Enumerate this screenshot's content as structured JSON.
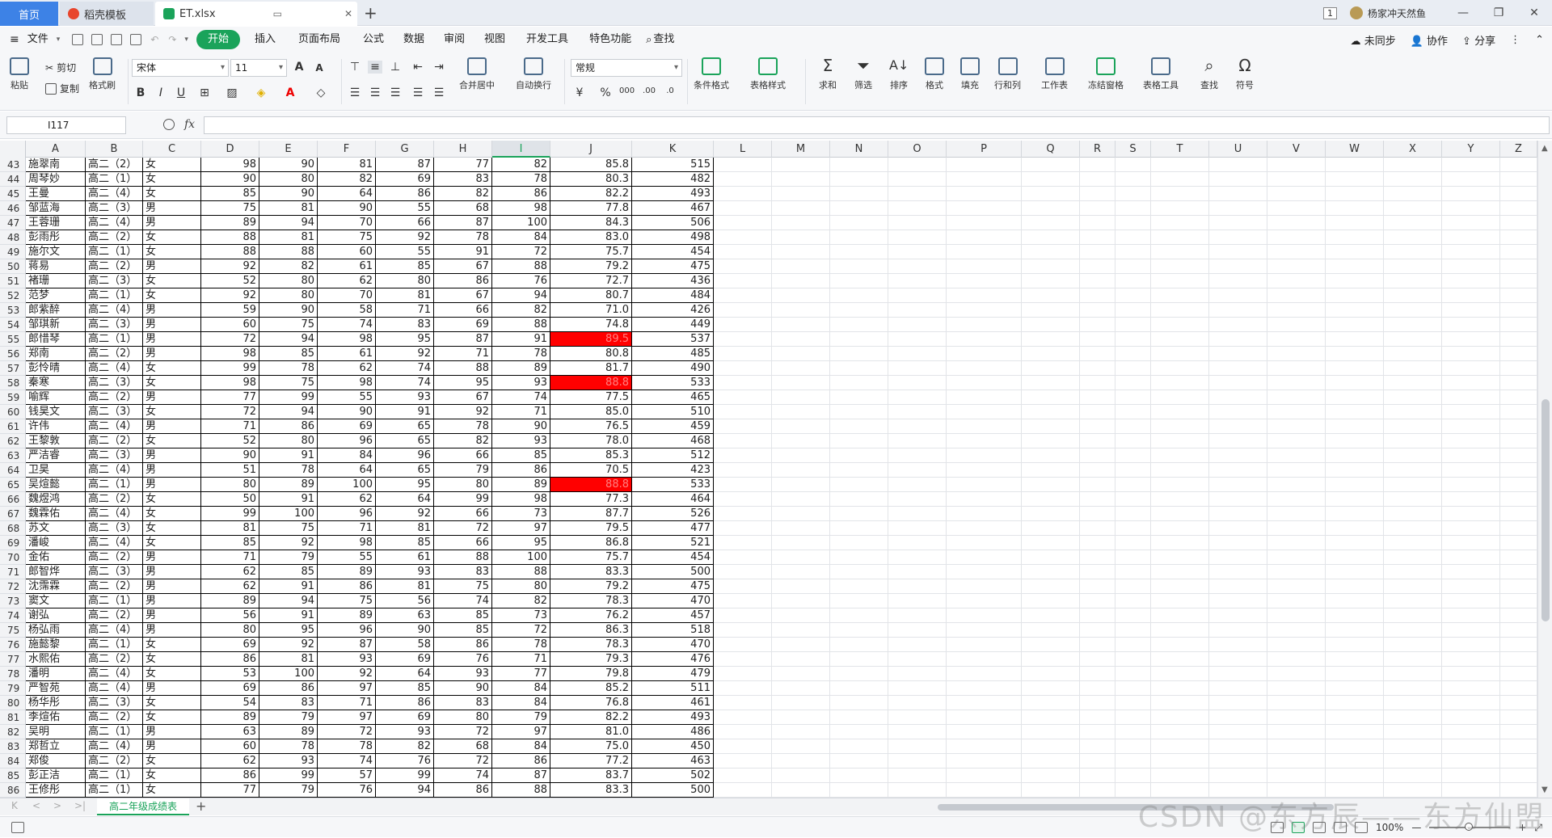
{
  "titlebar": {
    "tabs": [
      {
        "label": "首页"
      },
      {
        "label": "稻壳模板"
      },
      {
        "label": "ET.xlsx"
      }
    ],
    "window_badge": "1",
    "user_name": "杨家冲天然鱼"
  },
  "menubar": {
    "file_label": "文件",
    "items": [
      "开始",
      "插入",
      "页面布局",
      "公式",
      "数据",
      "审阅",
      "视图",
      "开发工具",
      "特色功能"
    ],
    "search_label": "查找",
    "right": [
      "未同步",
      "协作",
      "分享"
    ]
  },
  "ribbon": {
    "paste": "粘贴",
    "cut": "剪切",
    "copy": "复制",
    "format_painter": "格式刷",
    "font_name": "宋体",
    "font_size": "11",
    "merge_center": "合并居中",
    "auto_wrap": "自动换行",
    "number_format": "常规",
    "conditional_format": "条件格式",
    "table_style": "表格样式",
    "sum": "求和",
    "filter": "筛选",
    "sort": "排序",
    "format": "格式",
    "fill": "填充",
    "row_col": "行和列",
    "worksheet": "工作表",
    "freeze": "冻结窗格",
    "table_tools": "表格工具",
    "find": "查找",
    "symbol": "符号"
  },
  "formula_bar": {
    "cell_ref": "I117",
    "fx": "fx",
    "formula": ""
  },
  "columns": [
    "A",
    "B",
    "C",
    "D",
    "E",
    "F",
    "G",
    "H",
    "I",
    "J",
    "K",
    "L",
    "M",
    "N",
    "O",
    "P",
    "Q",
    "R",
    "S",
    "T",
    "U",
    "V",
    "W",
    "X",
    "Y",
    "Z"
  ],
  "selected_column": "I",
  "rows": [
    {
      "n": "43",
      "name": "施翠南",
      "cls": "高二（2）",
      "sex": "女",
      "d": "98",
      "e": "90",
      "f": "81",
      "g": "87",
      "h": "77",
      "i": "82",
      "j": "85.8",
      "k": "515",
      "red": false
    },
    {
      "n": "44",
      "name": "周琴妙",
      "cls": "高二（1）",
      "sex": "女",
      "d": "90",
      "e": "80",
      "f": "82",
      "g": "69",
      "h": "83",
      "i": "78",
      "j": "80.3",
      "k": "482",
      "red": false
    },
    {
      "n": "45",
      "name": "王曼",
      "cls": "高二（4）",
      "sex": "女",
      "d": "85",
      "e": "90",
      "f": "64",
      "g": "86",
      "h": "82",
      "i": "86",
      "j": "82.2",
      "k": "493",
      "red": false
    },
    {
      "n": "46",
      "name": "邹蓝海",
      "cls": "高二（3）",
      "sex": "男",
      "d": "75",
      "e": "81",
      "f": "90",
      "g": "55",
      "h": "68",
      "i": "98",
      "j": "77.8",
      "k": "467",
      "red": false
    },
    {
      "n": "47",
      "name": "王蓉珊",
      "cls": "高二（4）",
      "sex": "男",
      "d": "89",
      "e": "94",
      "f": "70",
      "g": "66",
      "h": "87",
      "i": "100",
      "j": "84.3",
      "k": "506",
      "red": false
    },
    {
      "n": "48",
      "name": "彭雨彤",
      "cls": "高二（2）",
      "sex": "女",
      "d": "88",
      "e": "81",
      "f": "75",
      "g": "92",
      "h": "78",
      "i": "84",
      "j": "83.0",
      "k": "498",
      "red": false
    },
    {
      "n": "49",
      "name": "施尔文",
      "cls": "高二（1）",
      "sex": "女",
      "d": "88",
      "e": "88",
      "f": "60",
      "g": "55",
      "h": "91",
      "i": "72",
      "j": "75.7",
      "k": "454",
      "red": false
    },
    {
      "n": "50",
      "name": "蒋易",
      "cls": "高二（2）",
      "sex": "男",
      "d": "92",
      "e": "82",
      "f": "61",
      "g": "85",
      "h": "67",
      "i": "88",
      "j": "79.2",
      "k": "475",
      "red": false
    },
    {
      "n": "51",
      "name": "褚珊",
      "cls": "高二（3）",
      "sex": "女",
      "d": "52",
      "e": "80",
      "f": "62",
      "g": "80",
      "h": "86",
      "i": "76",
      "j": "72.7",
      "k": "436",
      "red": false
    },
    {
      "n": "52",
      "name": "范梦",
      "cls": "高二（1）",
      "sex": "女",
      "d": "92",
      "e": "80",
      "f": "70",
      "g": "81",
      "h": "67",
      "i": "94",
      "j": "80.7",
      "k": "484",
      "red": false
    },
    {
      "n": "53",
      "name": "郎紫醉",
      "cls": "高二（4）",
      "sex": "男",
      "d": "59",
      "e": "90",
      "f": "58",
      "g": "71",
      "h": "66",
      "i": "82",
      "j": "71.0",
      "k": "426",
      "red": false
    },
    {
      "n": "54",
      "name": "邹琪新",
      "cls": "高二（3）",
      "sex": "男",
      "d": "60",
      "e": "75",
      "f": "74",
      "g": "83",
      "h": "69",
      "i": "88",
      "j": "74.8",
      "k": "449",
      "red": false
    },
    {
      "n": "55",
      "name": "郎惜琴",
      "cls": "高二（1）",
      "sex": "男",
      "d": "72",
      "e": "94",
      "f": "98",
      "g": "95",
      "h": "87",
      "i": "91",
      "j": "89.5",
      "k": "537",
      "red": true
    },
    {
      "n": "56",
      "name": "郑南",
      "cls": "高二（2）",
      "sex": "男",
      "d": "98",
      "e": "85",
      "f": "61",
      "g": "92",
      "h": "71",
      "i": "78",
      "j": "80.8",
      "k": "485",
      "red": false
    },
    {
      "n": "57",
      "name": "彭怜晴",
      "cls": "高二（4）",
      "sex": "女",
      "d": "99",
      "e": "78",
      "f": "62",
      "g": "74",
      "h": "88",
      "i": "89",
      "j": "81.7",
      "k": "490",
      "red": false
    },
    {
      "n": "58",
      "name": "秦寒",
      "cls": "高二（3）",
      "sex": "女",
      "d": "98",
      "e": "75",
      "f": "98",
      "g": "74",
      "h": "95",
      "i": "93",
      "j": "88.8",
      "k": "533",
      "red": true
    },
    {
      "n": "59",
      "name": "喻辉",
      "cls": "高二（2）",
      "sex": "男",
      "d": "77",
      "e": "99",
      "f": "55",
      "g": "93",
      "h": "67",
      "i": "74",
      "j": "77.5",
      "k": "465",
      "red": false
    },
    {
      "n": "60",
      "name": "钱昊文",
      "cls": "高二（3）",
      "sex": "女",
      "d": "72",
      "e": "94",
      "f": "90",
      "g": "91",
      "h": "92",
      "i": "71",
      "j": "85.0",
      "k": "510",
      "red": false
    },
    {
      "n": "61",
      "name": "许伟",
      "cls": "高二（4）",
      "sex": "男",
      "d": "71",
      "e": "86",
      "f": "69",
      "g": "65",
      "h": "78",
      "i": "90",
      "j": "76.5",
      "k": "459",
      "red": false
    },
    {
      "n": "62",
      "name": "王黎敦",
      "cls": "高二（2）",
      "sex": "女",
      "d": "52",
      "e": "80",
      "f": "96",
      "g": "65",
      "h": "82",
      "i": "93",
      "j": "78.0",
      "k": "468",
      "red": false
    },
    {
      "n": "63",
      "name": "严洁睿",
      "cls": "高二（3）",
      "sex": "男",
      "d": "90",
      "e": "91",
      "f": "84",
      "g": "96",
      "h": "66",
      "i": "85",
      "j": "85.3",
      "k": "512",
      "red": false
    },
    {
      "n": "64",
      "name": "卫昊",
      "cls": "高二（4）",
      "sex": "男",
      "d": "51",
      "e": "78",
      "f": "64",
      "g": "65",
      "h": "79",
      "i": "86",
      "j": "70.5",
      "k": "423",
      "red": false
    },
    {
      "n": "65",
      "name": "吴煊懿",
      "cls": "高二（1）",
      "sex": "男",
      "d": "80",
      "e": "89",
      "f": "100",
      "g": "95",
      "h": "80",
      "i": "89",
      "j": "88.8",
      "k": "533",
      "red": true
    },
    {
      "n": "66",
      "name": "魏煜鸿",
      "cls": "高二（2）",
      "sex": "女",
      "d": "50",
      "e": "91",
      "f": "62",
      "g": "64",
      "h": "99",
      "i": "98",
      "j": "77.3",
      "k": "464",
      "red": false
    },
    {
      "n": "67",
      "name": "魏霖佑",
      "cls": "高二（4）",
      "sex": "女",
      "d": "99",
      "e": "100",
      "f": "96",
      "g": "92",
      "h": "66",
      "i": "73",
      "j": "87.7",
      "k": "526",
      "red": false
    },
    {
      "n": "68",
      "name": "苏文",
      "cls": "高二（3）",
      "sex": "女",
      "d": "81",
      "e": "75",
      "f": "71",
      "g": "81",
      "h": "72",
      "i": "97",
      "j": "79.5",
      "k": "477",
      "red": false
    },
    {
      "n": "69",
      "name": "潘峻",
      "cls": "高二（4）",
      "sex": "女",
      "d": "85",
      "e": "92",
      "f": "98",
      "g": "85",
      "h": "66",
      "i": "95",
      "j": "86.8",
      "k": "521",
      "red": false
    },
    {
      "n": "70",
      "name": "金佑",
      "cls": "高二（2）",
      "sex": "男",
      "d": "71",
      "e": "79",
      "f": "55",
      "g": "61",
      "h": "88",
      "i": "100",
      "j": "75.7",
      "k": "454",
      "red": false
    },
    {
      "n": "71",
      "name": "郎智烨",
      "cls": "高二（3）",
      "sex": "男",
      "d": "62",
      "e": "85",
      "f": "89",
      "g": "93",
      "h": "83",
      "i": "88",
      "j": "83.3",
      "k": "500",
      "red": false
    },
    {
      "n": "72",
      "name": "沈霈霖",
      "cls": "高二（2）",
      "sex": "男",
      "d": "62",
      "e": "91",
      "f": "86",
      "g": "81",
      "h": "75",
      "i": "80",
      "j": "79.2",
      "k": "475",
      "red": false
    },
    {
      "n": "73",
      "name": "窦文",
      "cls": "高二（1）",
      "sex": "男",
      "d": "89",
      "e": "94",
      "f": "75",
      "g": "56",
      "h": "74",
      "i": "82",
      "j": "78.3",
      "k": "470",
      "red": false
    },
    {
      "n": "74",
      "name": "谢弘",
      "cls": "高二（2）",
      "sex": "男",
      "d": "56",
      "e": "91",
      "f": "89",
      "g": "63",
      "h": "85",
      "i": "73",
      "j": "76.2",
      "k": "457",
      "red": false
    },
    {
      "n": "75",
      "name": "杨弘雨",
      "cls": "高二（4）",
      "sex": "男",
      "d": "80",
      "e": "95",
      "f": "96",
      "g": "90",
      "h": "85",
      "i": "72",
      "j": "86.3",
      "k": "518",
      "red": false
    },
    {
      "n": "76",
      "name": "施懿黎",
      "cls": "高二（1）",
      "sex": "女",
      "d": "69",
      "e": "92",
      "f": "87",
      "g": "58",
      "h": "86",
      "i": "78",
      "j": "78.3",
      "k": "470",
      "red": false
    },
    {
      "n": "77",
      "name": "水熙佑",
      "cls": "高二（2）",
      "sex": "女",
      "d": "86",
      "e": "81",
      "f": "93",
      "g": "69",
      "h": "76",
      "i": "71",
      "j": "79.3",
      "k": "476",
      "red": false
    },
    {
      "n": "78",
      "name": "潘明",
      "cls": "高二（4）",
      "sex": "女",
      "d": "53",
      "e": "100",
      "f": "92",
      "g": "64",
      "h": "93",
      "i": "77",
      "j": "79.8",
      "k": "479",
      "red": false
    },
    {
      "n": "79",
      "name": "严智苑",
      "cls": "高二（4）",
      "sex": "男",
      "d": "69",
      "e": "86",
      "f": "97",
      "g": "85",
      "h": "90",
      "i": "84",
      "j": "85.2",
      "k": "511",
      "red": false
    },
    {
      "n": "80",
      "name": "杨华彤",
      "cls": "高二（3）",
      "sex": "女",
      "d": "54",
      "e": "83",
      "f": "71",
      "g": "86",
      "h": "83",
      "i": "84",
      "j": "76.8",
      "k": "461",
      "red": false
    },
    {
      "n": "81",
      "name": "李煊佑",
      "cls": "高二（2）",
      "sex": "女",
      "d": "89",
      "e": "79",
      "f": "97",
      "g": "69",
      "h": "80",
      "i": "79",
      "j": "82.2",
      "k": "493",
      "red": false
    },
    {
      "n": "82",
      "name": "吴明",
      "cls": "高二（1）",
      "sex": "男",
      "d": "63",
      "e": "89",
      "f": "72",
      "g": "93",
      "h": "72",
      "i": "97",
      "j": "81.0",
      "k": "486",
      "red": false
    },
    {
      "n": "83",
      "name": "郑哲立",
      "cls": "高二（4）",
      "sex": "男",
      "d": "60",
      "e": "78",
      "f": "78",
      "g": "82",
      "h": "68",
      "i": "84",
      "j": "75.0",
      "k": "450",
      "red": false
    },
    {
      "n": "84",
      "name": "郑俊",
      "cls": "高二（2）",
      "sex": "女",
      "d": "62",
      "e": "93",
      "f": "74",
      "g": "76",
      "h": "72",
      "i": "86",
      "j": "77.2",
      "k": "463",
      "red": false
    },
    {
      "n": "85",
      "name": "彭正洁",
      "cls": "高二（1）",
      "sex": "女",
      "d": "86",
      "e": "99",
      "f": "57",
      "g": "99",
      "h": "74",
      "i": "87",
      "j": "83.7",
      "k": "502",
      "red": false
    },
    {
      "n": "86",
      "name": "王修彤",
      "cls": "高二（1）",
      "sex": "女",
      "d": "77",
      "e": "79",
      "f": "76",
      "g": "94",
      "h": "86",
      "i": "88",
      "j": "83.3",
      "k": "500",
      "red": false
    }
  ],
  "sheet_tab": "高二年级成绩表",
  "status": {
    "zoom": "100%"
  },
  "watermark": "CSDN @东方辰——东方仙盟",
  "colors": {
    "accent": "#1aa35a",
    "highlight": "#ff0000",
    "home_tab": "#3d82e6"
  }
}
